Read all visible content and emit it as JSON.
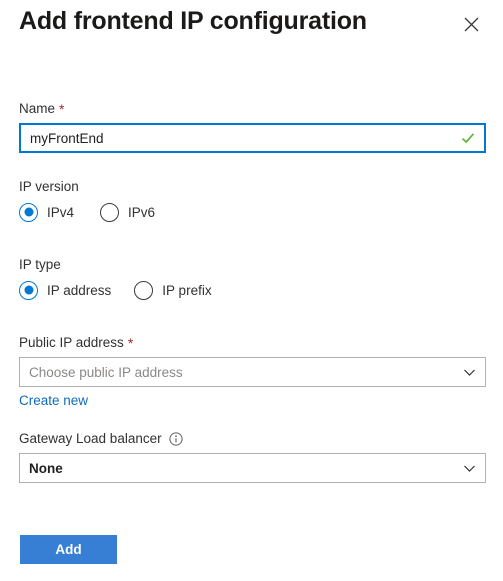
{
  "panel": {
    "title": "Add frontend IP configuration",
    "close_icon": "close-icon"
  },
  "form": {
    "name_field": {
      "label": "Name",
      "required_marker": "*",
      "value": "myFrontEnd",
      "placeholder": "",
      "validation_icon": "checkmark-icon"
    },
    "ip_version": {
      "label": "IP version",
      "options": [
        {
          "label": "IPv4",
          "selected": true
        },
        {
          "label": "IPv6",
          "selected": false
        }
      ]
    },
    "ip_type": {
      "label": "IP type",
      "options": [
        {
          "label": "IP address",
          "selected": true
        },
        {
          "label": "IP prefix",
          "selected": false
        }
      ]
    },
    "public_ip_address": {
      "label": "Public IP address",
      "required_marker": "*",
      "placeholder": "Choose public IP address",
      "value": "",
      "chevron_icon": "chevron-down-icon",
      "create_new_link": "Create new"
    },
    "gateway_load_balancer": {
      "label": "Gateway Load balancer",
      "info_icon": "info-icon",
      "value": "None",
      "chevron_icon": "chevron-down-icon"
    }
  },
  "footer": {
    "add_label": "Add"
  },
  "colors": {
    "accent": "#0078d4",
    "primary_button": "#377fd4",
    "link": "#0f6cbd",
    "required": "#a4262c",
    "success": "#5fb733",
    "border": "#b3b0ad",
    "placeholder": "#8a8886"
  }
}
